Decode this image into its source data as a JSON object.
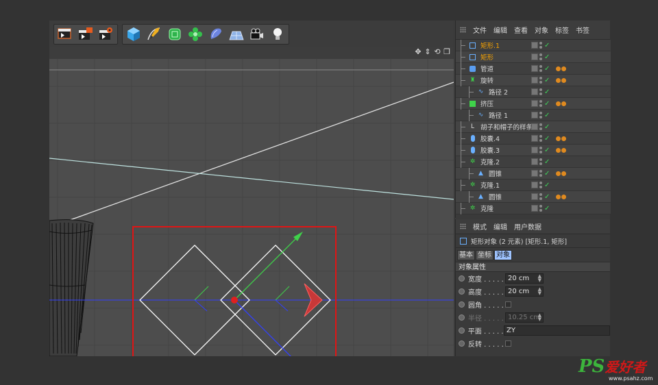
{
  "object_manager": {
    "menu": [
      "文件",
      "编辑",
      "查看",
      "对象",
      "标签",
      "书签"
    ],
    "rows": [
      {
        "name": "矩形.1",
        "selected": true,
        "icon": "rect-spline-icon",
        "tags": 0,
        "indent": 1
      },
      {
        "name": "矩形",
        "selected": true,
        "icon": "rect-spline-icon",
        "tags": 0,
        "indent": 1
      },
      {
        "name": "管道",
        "selected": false,
        "icon": "tube-icon",
        "tags": 2,
        "indent": 1
      },
      {
        "name": "旋转",
        "selected": false,
        "icon": "lathe-icon",
        "tags": 2,
        "indent": 0
      },
      {
        "name": "路径 2",
        "selected": false,
        "icon": "spline-icon",
        "tags": 0,
        "indent": 2
      },
      {
        "name": "挤压",
        "selected": false,
        "icon": "extrude-icon",
        "tags": 2,
        "indent": 0
      },
      {
        "name": "路径 1",
        "selected": false,
        "icon": "spline-icon",
        "tags": 0,
        "indent": 2
      },
      {
        "name": "胡子和帽子的样条",
        "selected": false,
        "icon": "null-icon",
        "tags": 0,
        "indent": 1
      },
      {
        "name": "胶囊.4",
        "selected": false,
        "icon": "capsule-icon",
        "tags": 2,
        "indent": 1
      },
      {
        "name": "胶囊.3",
        "selected": false,
        "icon": "capsule-icon",
        "tags": 2,
        "indent": 1
      },
      {
        "name": "克隆.2",
        "selected": false,
        "icon": "cloner-icon",
        "tags": 0,
        "indent": 0
      },
      {
        "name": "圆锥",
        "selected": false,
        "icon": "cone-icon",
        "tags": 2,
        "indent": 2
      },
      {
        "name": "克隆.1",
        "selected": false,
        "icon": "cloner-icon",
        "tags": 0,
        "indent": 0
      },
      {
        "name": "圆锥",
        "selected": false,
        "icon": "cone-icon",
        "tags": 2,
        "indent": 2
      },
      {
        "name": "克隆",
        "selected": false,
        "icon": "cloner-icon",
        "tags": 0,
        "indent": 0
      }
    ]
  },
  "attribute_manager": {
    "menu": [
      "模式",
      "编辑",
      "用户数据"
    ],
    "title": "矩形对象 (2 元素) [矩形.1, 矩形]",
    "tabs": [
      "基本",
      "坐标",
      "对象"
    ],
    "active_tab": 2,
    "section": "对象属性",
    "fields": [
      {
        "label": "宽度 . . . . .",
        "value": "20 cm",
        "type": "number",
        "disabled": false
      },
      {
        "label": "高度 . . . . .",
        "value": "20 cm",
        "type": "number",
        "disabled": false
      },
      {
        "label": "圆角 . . . . .",
        "value": "",
        "type": "checkbox",
        "disabled": false
      },
      {
        "label": "半径 . . . . .",
        "value": "10.25 cm",
        "type": "number",
        "disabled": true
      },
      {
        "label": "平面 . . . . .",
        "value": "ZY",
        "type": "select",
        "disabled": false
      },
      {
        "label": "反转 . . . . .",
        "value": "",
        "type": "checkbox",
        "disabled": false
      }
    ]
  },
  "toolbar": {
    "groups": [
      [
        "render-view-icon",
        "render-picture-viewer-icon",
        "render-settings-icon"
      ],
      [
        "cube-icon",
        "pen-spline-icon",
        "subdivision-icon",
        "cloner-icon",
        "deformer-icon",
        "floor-icon",
        "camera-icon",
        "light-icon"
      ]
    ]
  },
  "colors": {
    "selection_box": "#e01515",
    "spline": "#ffffff",
    "x_axis": "#d94040",
    "y_axis": "#3fd24a",
    "z_axis": "#3240ff",
    "selected_name": "#f6a200",
    "check": "#3fd35a",
    "tag": "#e08a1f"
  },
  "watermark": {
    "ps": "PS",
    "cn": "爱好者",
    "url": "www.psahz.com"
  }
}
